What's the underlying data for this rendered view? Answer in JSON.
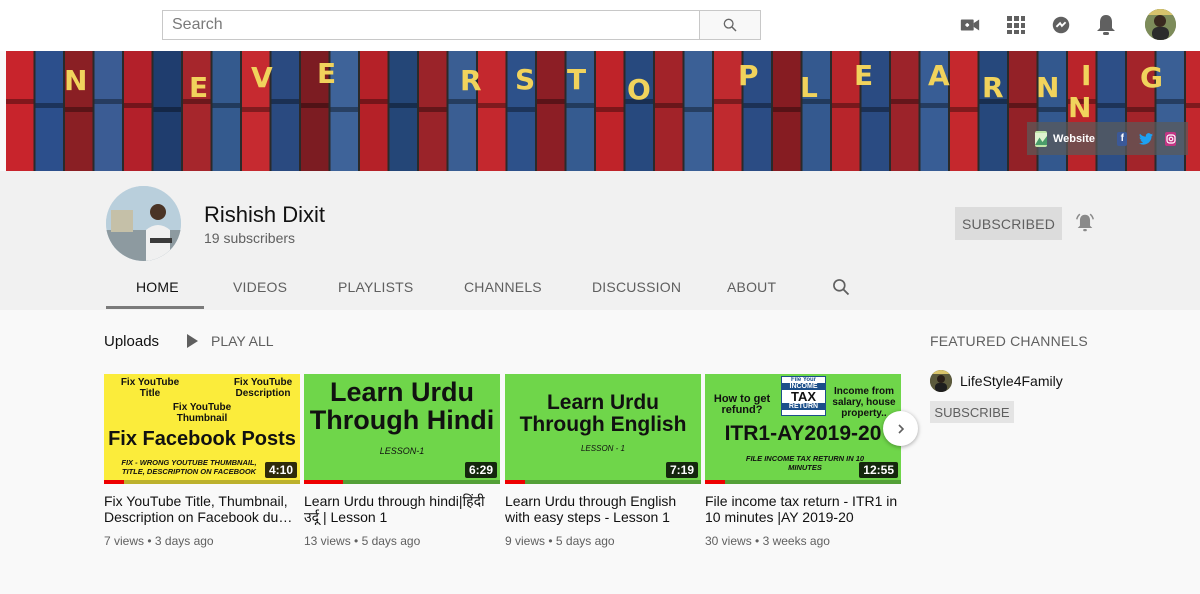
{
  "search": {
    "placeholder": "Search"
  },
  "topbar": {
    "icons": [
      "create-video-icon",
      "apps-grid-icon",
      "messages-icon",
      "notifications-bell-icon"
    ]
  },
  "banner": {
    "letters": [
      "N",
      "E",
      "V",
      "E",
      "R",
      "S",
      "T",
      "O",
      "P",
      "L",
      "E",
      "A",
      "R",
      "N",
      "I",
      "N",
      "G"
    ],
    "links": {
      "website_label": "Website"
    }
  },
  "channel": {
    "name": "Rishish Dixit",
    "subscribers": "19 subscribers",
    "subscribed_label": "SUBSCRIBED"
  },
  "tabs": [
    {
      "label": "HOME"
    },
    {
      "label": "VIDEOS"
    },
    {
      "label": "PLAYLISTS"
    },
    {
      "label": "CHANNELS"
    },
    {
      "label": "DISCUSSION"
    },
    {
      "label": "ABOUT"
    }
  ],
  "uploads": {
    "title": "Uploads",
    "play_all_label": "PLAY ALL",
    "videos": [
      {
        "title": "Fix YouTube Title, Thumbnail, Description on Facebook du…",
        "views": "7 views",
        "age": "3 days ago",
        "duration": "4:10",
        "progress": 0.1,
        "thumb": {
          "top_left": "Fix YouTube Title",
          "top_right": "Fix YouTube Description",
          "middle": "Fix YouTube Thumbnail",
          "headline": "Fix Facebook Posts",
          "footer": "FIX - WRONG YOUTUBE THUMBNAIL, TITLE, DESCRIPTION ON FACEBOOK"
        }
      },
      {
        "title": "Learn Urdu through hindi|हिंदी उर्दू | Lesson 1",
        "views": "13 views",
        "age": "5 days ago",
        "duration": "6:29",
        "progress": 0.2,
        "thumb": {
          "line1": "Learn Urdu",
          "line2": "Through Hindi",
          "sub": "LESSON-1"
        }
      },
      {
        "title": "Learn Urdu through English with easy steps - Lesson 1",
        "views": "9 views",
        "age": "5 days ago",
        "duration": "7:19",
        "progress": 0.1,
        "thumb": {
          "line1": "Learn Urdu",
          "line2": "Through English",
          "sub": "LESSON - 1"
        }
      },
      {
        "title": "File income tax return - ITR1 in 10 minutes |AY 2019-20",
        "views": "30 views",
        "age": "3 weeks ago",
        "duration": "12:55",
        "progress": 0.1,
        "thumb": {
          "left": "How to get refund?",
          "badge_top": "File Your",
          "badge_mid": "INCOME",
          "badge_big": "TAX",
          "badge_bot": "RETURN",
          "right": "Income from salary, house property..",
          "headline": "ITR1-AY2019-20",
          "footer": "FILE INCOME TAX RETURN IN 10 MINUTES"
        }
      }
    ]
  },
  "featured": {
    "title": "FEATURED CHANNELS",
    "channels": [
      {
        "name": "LifeStyle4Family",
        "subscribe_label": "SUBSCRIBE"
      }
    ]
  },
  "colors": {
    "accent_red": "#ee0000",
    "thumb_yellow": "#fbec3b",
    "thumb_green": "#6fd64a"
  }
}
